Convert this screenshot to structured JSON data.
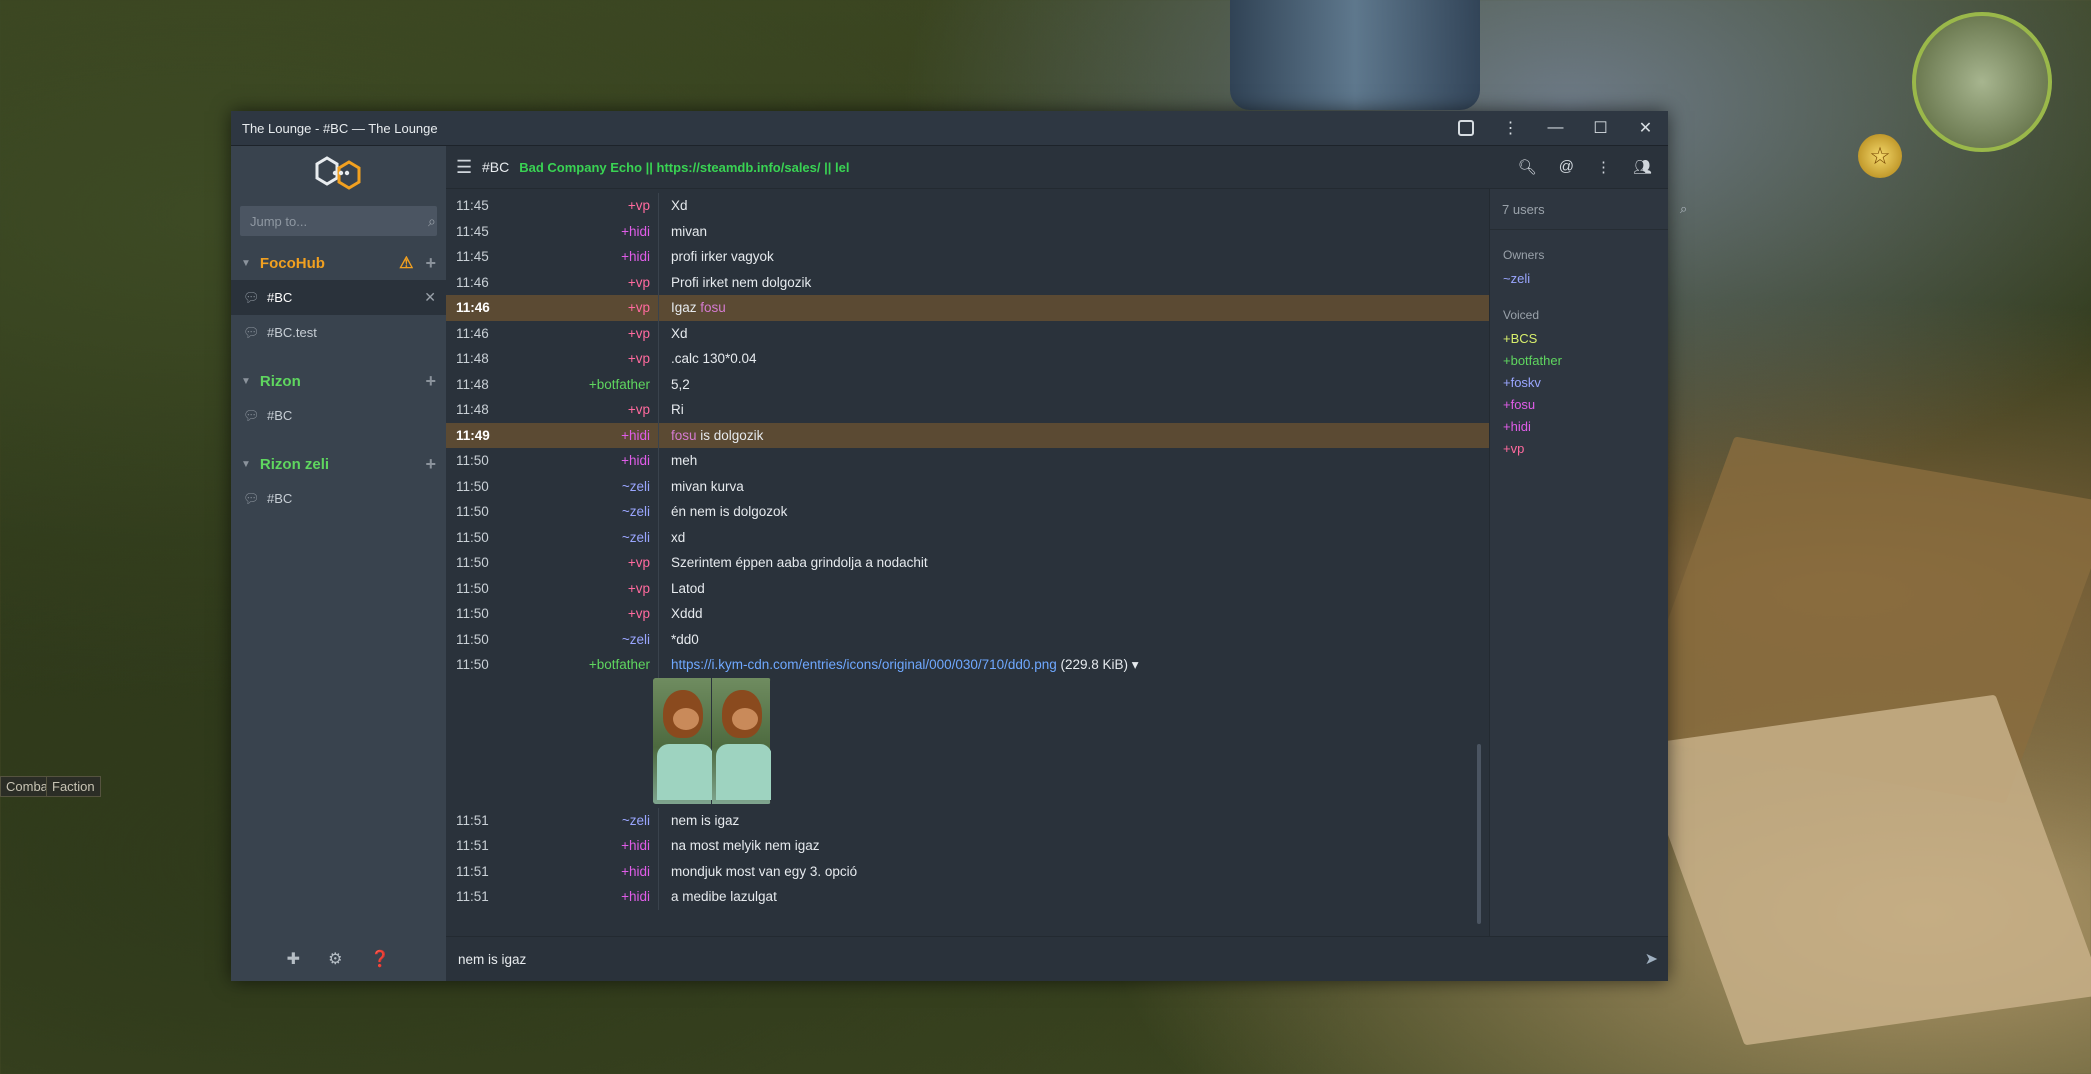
{
  "window": {
    "title": "The Lounge - #BC — The Lounge"
  },
  "game": {
    "tabs": [
      "Combat",
      "Faction"
    ]
  },
  "sidebar": {
    "jump_placeholder": "Jump to...",
    "networks": [
      {
        "name": "FocoHub",
        "color": "#f1a020",
        "warning": true,
        "channels": [
          {
            "name": "#BC",
            "active": true
          },
          {
            "name": "#BC.test",
            "active": false
          }
        ]
      },
      {
        "name": "Rizon",
        "color": "#5fd65f",
        "warning": false,
        "channels": [
          {
            "name": "#BC",
            "active": false
          }
        ]
      },
      {
        "name": "Rizon zeli",
        "color": "#5fd65f",
        "warning": false,
        "channels": [
          {
            "name": "#BC",
            "active": false
          }
        ]
      }
    ]
  },
  "channel": {
    "name": "#BC",
    "topic": "Bad Company Echo || https://steamdb.info/sales/ || lel"
  },
  "messages": [
    {
      "time": "11:45",
      "nick": "+vp",
      "cls": "n-vp",
      "text": "Xd"
    },
    {
      "time": "11:45",
      "nick": "+hidi",
      "cls": "n-hidi",
      "text": "mivan"
    },
    {
      "time": "11:45",
      "nick": "+hidi",
      "cls": "n-hidi",
      "text": "profi irker vagyok"
    },
    {
      "time": "11:46",
      "nick": "+vp",
      "cls": "n-vp",
      "text": "Profi irket nem dolgozik"
    },
    {
      "time": "11:46",
      "nick": "+vp",
      "cls": "n-vp",
      "text": "Igaz",
      "mention": "fosu",
      "mention_first": false,
      "highlight": true
    },
    {
      "time": "11:46",
      "nick": "+vp",
      "cls": "n-vp",
      "text": "Xd"
    },
    {
      "time": "11:48",
      "nick": "+vp",
      "cls": "n-vp",
      "text": ".calc 130*0.04"
    },
    {
      "time": "11:48",
      "nick": "+botfather",
      "cls": "n-bot",
      "text": "5,2"
    },
    {
      "time": "11:48",
      "nick": "+vp",
      "cls": "n-vp",
      "text": "Ri"
    },
    {
      "time": "11:49",
      "nick": "+hidi",
      "cls": "n-hidi",
      "text": "is dolgozik",
      "mention": "fosu",
      "mention_first": true,
      "highlight": true
    },
    {
      "time": "11:50",
      "nick": "+hidi",
      "cls": "n-hidi",
      "text": "meh"
    },
    {
      "time": "11:50",
      "nick": "~zeli",
      "cls": "n-zeli",
      "text": "mivan kurva"
    },
    {
      "time": "11:50",
      "nick": "~zeli",
      "cls": "n-zeli",
      "text": "én nem is dolgozok"
    },
    {
      "time": "11:50",
      "nick": "~zeli",
      "cls": "n-zeli",
      "text": "xd"
    },
    {
      "time": "11:50",
      "nick": "+vp",
      "cls": "n-vp",
      "text": "Szerintem éppen aaba grindolja a nodachit"
    },
    {
      "time": "11:50",
      "nick": "+vp",
      "cls": "n-vp",
      "text": "Latod"
    },
    {
      "time": "11:50",
      "nick": "+vp",
      "cls": "n-vp",
      "text": "Xddd"
    },
    {
      "time": "11:50",
      "nick": "~zeli",
      "cls": "n-zeli",
      "text": "*dd0"
    },
    {
      "time": "11:50",
      "nick": "+botfather",
      "cls": "n-bot",
      "link": "https://i.kym-cdn.com/entries/icons/original/000/030/710/dd0.png",
      "size": "(229.8 KiB)",
      "preview": true
    },
    {
      "time": "11:51",
      "nick": "~zeli",
      "cls": "n-zeli",
      "text": "nem is igaz"
    },
    {
      "time": "11:51",
      "nick": "+hidi",
      "cls": "n-hidi",
      "text": "na most melyik nem igaz"
    },
    {
      "time": "11:51",
      "nick": "+hidi",
      "cls": "n-hidi",
      "text": "mondjuk most van egy 3. opció"
    },
    {
      "time": "11:51",
      "nick": "+hidi",
      "cls": "n-hidi",
      "text": "a medibe lazulgat"
    }
  ],
  "users": {
    "search_placeholder": "7 users",
    "groups": [
      {
        "label": "Owners",
        "members": [
          {
            "name": "~zeli",
            "cls": "n-zeli"
          }
        ]
      },
      {
        "label": "Voiced",
        "members": [
          {
            "name": "+BCS",
            "cls": "n-bcs"
          },
          {
            "name": "+botfather",
            "cls": "n-bot"
          },
          {
            "name": "+foskv",
            "cls": "n-zeli"
          },
          {
            "name": "+fosu",
            "cls": "n-hidi"
          },
          {
            "name": "+hidi",
            "cls": "n-hidi"
          },
          {
            "name": "+vp",
            "cls": "n-vp"
          }
        ]
      }
    ]
  },
  "composer": {
    "value": "nem is igaz"
  },
  "colors": {
    "accent_orange": "#f1a020",
    "accent_green": "#39d353",
    "highlight_row": "#5b4a33"
  }
}
